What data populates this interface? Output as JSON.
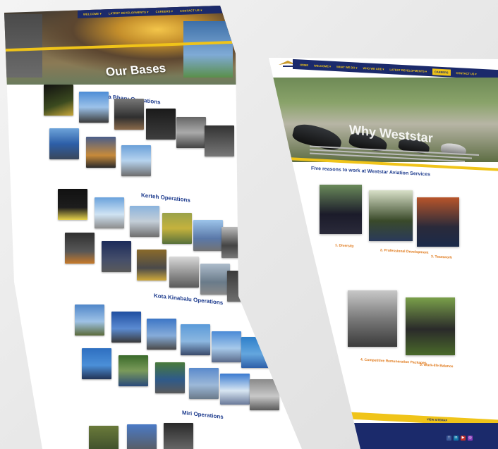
{
  "left_page": {
    "nav": [
      "WELCOME ▾",
      "LATEST DEVELOPMENTS ▾",
      "CAREERS ▾",
      "CONTACT US ▾"
    ],
    "hero_title": "Our Bases",
    "sections": [
      {
        "title": "Kota Bharu Operations"
      },
      {
        "title": "Kerteh Operations"
      },
      {
        "title": "Kota Kinabalu Operations"
      },
      {
        "title": "Miri Operations"
      }
    ]
  },
  "right_page": {
    "nav": [
      "HOME",
      "WELCOME ▾",
      "WHAT WE DO ▾",
      "WHO WE ARE ▾",
      "LATEST DEVELOPMENTS ▾",
      "CAREERS",
      "CONTACT US ▾"
    ],
    "nav_active_index": 5,
    "hero_title": "Why Weststar",
    "heading": "Five reasons to work at Weststar Aviation Services",
    "reasons": [
      {
        "title": "1. Diversity"
      },
      {
        "title": "2. Professional Development"
      },
      {
        "title": "3. Teamwork"
      },
      {
        "title": "4. Competitive Remuneration Packages"
      },
      {
        "title": "5. Work-life Balance"
      }
    ],
    "footer_button": "VIEW SITEMAP",
    "social": [
      "f",
      "in",
      "▶",
      "◎"
    ]
  },
  "colors": {
    "navy": "#1b2a6b",
    "yellow": "#f0c419",
    "heading_blue": "#1e3c8e",
    "accent_orange": "#e07a1c"
  }
}
